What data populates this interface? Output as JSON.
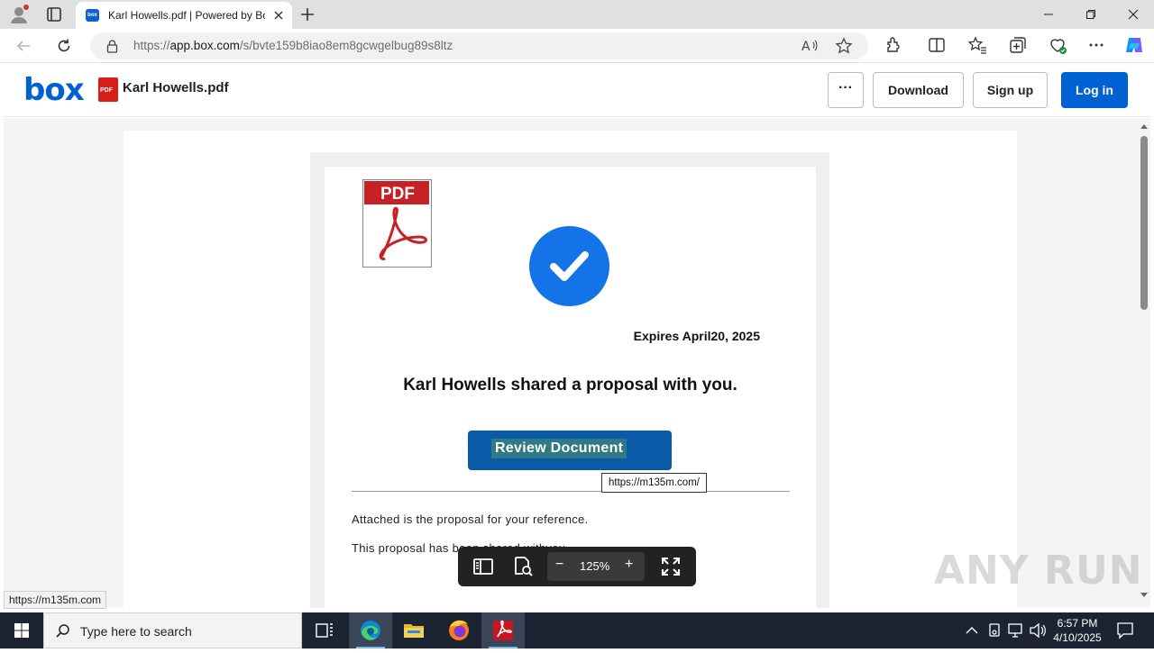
{
  "browser": {
    "tab_title": "Karl Howells.pdf | Powered by Box",
    "tab_favicon_text": "box",
    "url_prefix": "https://",
    "url_host": "app.box.com",
    "url_path": "/s/bvte159b8iao8em8gcwgelbug89s8ltz"
  },
  "header": {
    "logo": "box",
    "file_badge": "PDF",
    "filename": "Karl Howells.pdf",
    "more_label": "···",
    "download_label": "Download",
    "signup_label": "Sign up",
    "login_label": "Log in",
    "brand_color": "#0061d5"
  },
  "document": {
    "pdf_label": "PDF",
    "expires": "Expires April20, 2025",
    "headline": "Karl Howells shared a proposal with you.",
    "review_button": "Review Document",
    "line1": "Attached is the proposal for your reference.",
    "line2": "This proposal has been shared withyou.",
    "link_tooltip": "https://m135m.com/"
  },
  "viewer": {
    "zoom": "125%",
    "status_url": "https://m135m.com"
  },
  "watermark": "ANY RUN",
  "taskbar": {
    "search_placeholder": "Type here to search",
    "time": "6:57 PM",
    "date": "4/10/2025"
  }
}
